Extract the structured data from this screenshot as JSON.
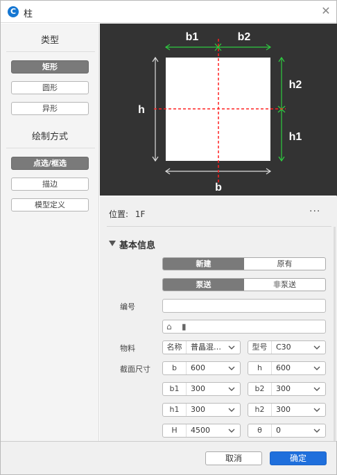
{
  "window": {
    "title": "柱",
    "logo_letter": "C"
  },
  "left": {
    "type_heading": "类型",
    "type_buttons": [
      "矩形",
      "圆形",
      "异形"
    ],
    "draw_heading": "绘制方式",
    "draw_buttons": [
      "点选/框选",
      "描边",
      "模型定义"
    ]
  },
  "preview": {
    "labels": {
      "b1": "b1",
      "b2": "b2",
      "h2": "h2",
      "h1": "h1",
      "h": "h",
      "b": "b"
    }
  },
  "panel": {
    "position_label": "位置:",
    "position_value": "1F",
    "more": "···",
    "section_title": "基本信息",
    "segments": [
      {
        "options": [
          "新建",
          "原有"
        ],
        "selected": "新建"
      },
      {
        "options": [
          "泵送",
          "非泵送"
        ],
        "selected": "泵送"
      }
    ],
    "code_label": "编号",
    "code_value": "",
    "material_label": "物料",
    "name_key": "名称",
    "name_value": "普晶混…",
    "model_key": "型号",
    "model_value": "C30",
    "section_size_label": "截面尺寸",
    "dims": [
      {
        "k": "b",
        "v": "600"
      },
      {
        "k": "h",
        "v": "600"
      },
      {
        "k": "b1",
        "v": "300"
      },
      {
        "k": "b2",
        "v": "300"
      },
      {
        "k": "h1",
        "v": "300"
      },
      {
        "k": "h2",
        "v": "300"
      },
      {
        "k": "H",
        "v": "4500"
      },
      {
        "k": "θ",
        "v": "0"
      }
    ]
  },
  "footer": {
    "cancel": "取消",
    "ok": "确定"
  },
  "colors": {
    "accent": "#1f6fdc",
    "green": "#2ecc40",
    "red": "#ff2020",
    "dark": "#333333"
  }
}
